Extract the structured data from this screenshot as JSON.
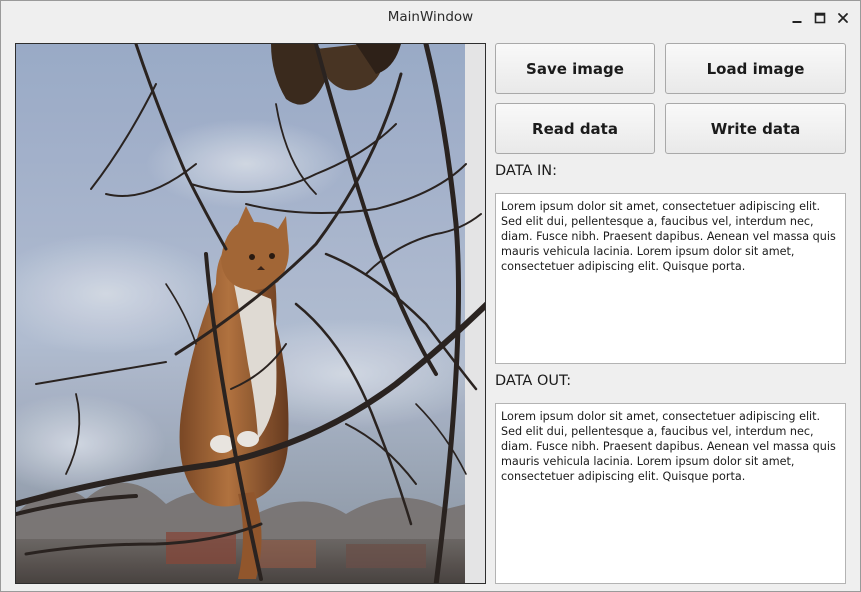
{
  "window": {
    "title": "MainWindow",
    "controls": {
      "minimize_icon": "minimize-icon",
      "maximize_icon": "maximize-icon",
      "close_icon": "close-icon"
    }
  },
  "image_view": {
    "subject": "photo of an orange and white cat sitting among bare tree branches against a cloudy blue sky"
  },
  "buttons": {
    "save_image": "Save image",
    "load_image": "Load image",
    "read_data": "Read data",
    "write_data": "Write data"
  },
  "data_in": {
    "label": "DATA IN:",
    "text": "Lorem ipsum dolor sit amet, consectetuer adipiscing elit. Sed elit dui, pellentesque a, faucibus vel, interdum nec, diam. Fusce nibh. Praesent dapibus. Aenean vel massa quis mauris vehicula lacinia. Lorem ipsum dolor sit amet, consectetuer adipiscing elit. Quisque porta."
  },
  "data_out": {
    "label": "DATA OUT:",
    "text": "Lorem ipsum dolor sit amet, consectetuer adipiscing elit. Sed elit dui, pellentesque a, faucibus vel, interdum nec, diam. Fusce nibh. Praesent dapibus. Aenean vel massa quis mauris vehicula lacinia. Lorem ipsum dolor sit amet, consectetuer adipiscing elit. Quisque porta."
  },
  "colors": {
    "window_bg": "#efefef",
    "sky": "#a9b7cf",
    "cat_fur": "#b06a30"
  }
}
